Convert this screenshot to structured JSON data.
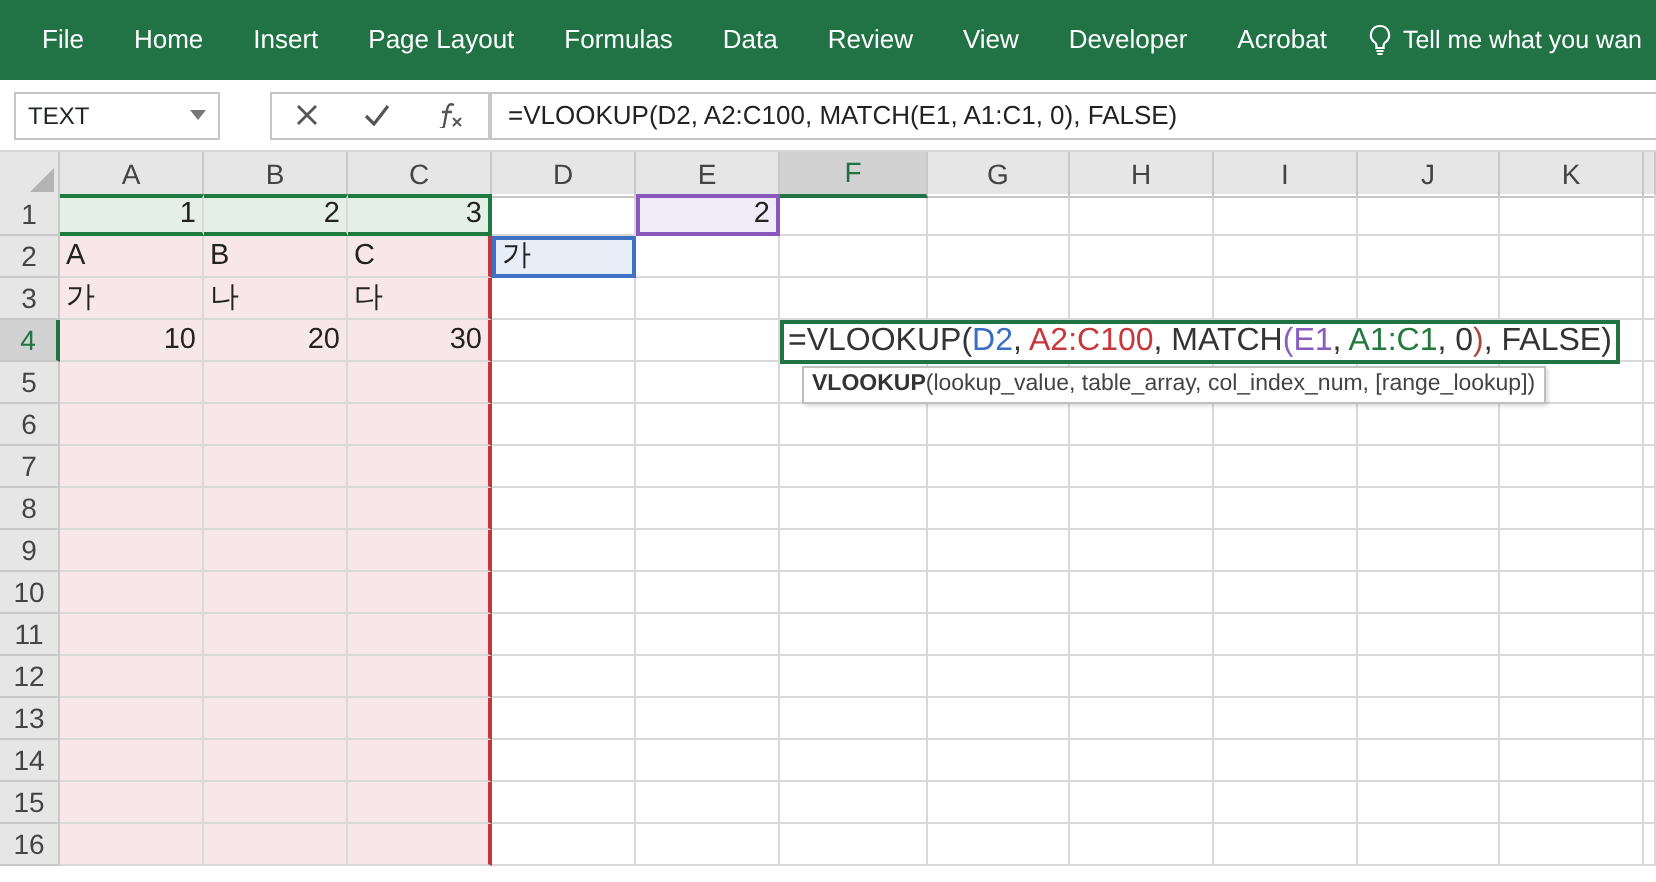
{
  "ribbon": {
    "tabs": [
      "File",
      "Home",
      "Insert",
      "Page Layout",
      "Formulas",
      "Data",
      "Review",
      "View",
      "Developer",
      "Acrobat"
    ],
    "tell_me": "Tell me what you wan"
  },
  "name_box": {
    "value": "TEXT"
  },
  "formula_bar": {
    "value": "=VLOOKUP(D2, A2:C100, MATCH(E1, A1:C1, 0), FALSE)"
  },
  "columns": [
    {
      "label": "A",
      "selected": false
    },
    {
      "label": "B",
      "selected": false
    },
    {
      "label": "C",
      "selected": false
    },
    {
      "label": "D",
      "selected": false
    },
    {
      "label": "E",
      "selected": false
    },
    {
      "label": "F",
      "selected": true
    },
    {
      "label": "G",
      "selected": false
    },
    {
      "label": "H",
      "selected": false
    },
    {
      "label": "I",
      "selected": false
    },
    {
      "label": "J",
      "selected": false
    },
    {
      "label": "K",
      "selected": false
    }
  ],
  "rows": [
    {
      "label": "1",
      "selected": false,
      "cells": [
        {
          "value": "1",
          "kind": "number",
          "color": "#e4efe8"
        },
        {
          "value": "2",
          "kind": "number",
          "color": "#e4efe8"
        },
        {
          "value": "3",
          "kind": "number",
          "color": "#e4efe8"
        },
        null,
        {
          "value": "2",
          "kind": "number",
          "color": "#f1ebf7"
        },
        null,
        null,
        null,
        null,
        null,
        null
      ]
    },
    {
      "label": "2",
      "selected": false,
      "cells": [
        {
          "value": "A",
          "kind": "text",
          "color": "#f8e7e8"
        },
        {
          "value": "B",
          "kind": "text",
          "color": "#f8e7e8"
        },
        {
          "value": "C",
          "kind": "text",
          "color": "#f8e7e8"
        },
        {
          "value": "가",
          "kind": "text",
          "color": "#e8eef8"
        },
        null,
        null,
        null,
        null,
        null,
        null,
        null
      ]
    },
    {
      "label": "3",
      "selected": false,
      "cells": [
        {
          "value": "가",
          "kind": "text",
          "color": "#f8e7e8"
        },
        {
          "value": "나",
          "kind": "text",
          "color": "#f8e7e8"
        },
        {
          "value": "다",
          "kind": "text",
          "color": "#f8e7e8"
        },
        null,
        null,
        null,
        null,
        null,
        null,
        null,
        null
      ]
    },
    {
      "label": "4",
      "selected": true,
      "cells": [
        {
          "value": "10",
          "kind": "number",
          "color": "#f8e7e8"
        },
        {
          "value": "20",
          "kind": "number",
          "color": "#f8e7e8"
        },
        {
          "value": "30",
          "kind": "number",
          "color": "#f8e7e8"
        },
        null,
        null,
        {
          "kind": "editing",
          "segments": [
            {
              "text": "=VLOOKUP(",
              "color": "#333333"
            },
            {
              "text": "D2",
              "color": "#3b6fc4"
            },
            {
              "text": ", ",
              "color": "#333333"
            },
            {
              "text": "A2:C100",
              "color": "#c8373b"
            },
            {
              "text": ", MATCH",
              "color": "#333333"
            },
            {
              "text": "(E1",
              "color": "#8a5cc0"
            },
            {
              "text": ", ",
              "color": "#333333"
            },
            {
              "text": "A1:C1",
              "color": "#217a3c"
            },
            {
              "text": ", 0",
              "color": "#333333"
            },
            {
              "text": ")",
              "color": "#a84a3a"
            },
            {
              "text": ", FALSE)",
              "color": "#333333"
            }
          ],
          "tooltip": "**VLOOKUP**(lookup_value, table_array, col_index_num, [range_lookup])"
        },
        null,
        null,
        null,
        null,
        null
      ]
    },
    {
      "label": "5",
      "selected": false,
      "cells": [
        {
          "color": "#f8e7e8"
        },
        {
          "color": "#f8e7e8"
        },
        {
          "color": "#f8e7e8"
        },
        null,
        null,
        null,
        null,
        null,
        null,
        null,
        null
      ]
    },
    {
      "label": "6",
      "selected": false,
      "cells": [
        {
          "color": "#f8e7e8"
        },
        {
          "color": "#f8e7e8"
        },
        {
          "color": "#f8e7e8"
        },
        null,
        null,
        null,
        null,
        null,
        null,
        null,
        null
      ]
    },
    {
      "label": "7",
      "selected": false,
      "cells": [
        {
          "color": "#f8e7e8"
        },
        {
          "color": "#f8e7e8"
        },
        {
          "color": "#f8e7e8"
        },
        null,
        null,
        null,
        null,
        null,
        null,
        null,
        null
      ]
    },
    {
      "label": "8",
      "selected": false,
      "cells": [
        {
          "color": "#f8e7e8"
        },
        {
          "color": "#f8e7e8"
        },
        {
          "color": "#f8e7e8"
        },
        null,
        null,
        null,
        null,
        null,
        null,
        null,
        null
      ]
    },
    {
      "label": "9",
      "selected": false,
      "cells": [
        {
          "color": "#f8e7e8"
        },
        {
          "color": "#f8e7e8"
        },
        {
          "color": "#f8e7e8"
        },
        null,
        null,
        null,
        null,
        null,
        null,
        null,
        null
      ]
    },
    {
      "label": "10",
      "selected": false,
      "cells": [
        {
          "color": "#f8e7e8"
        },
        {
          "color": "#f8e7e8"
        },
        {
          "color": "#f8e7e8"
        },
        null,
        null,
        null,
        null,
        null,
        null,
        null,
        null
      ]
    },
    {
      "label": "11",
      "selected": false,
      "cells": [
        {
          "color": "#f8e7e8"
        },
        {
          "color": "#f8e7e8"
        },
        {
          "color": "#f8e7e8"
        },
        null,
        null,
        null,
        null,
        null,
        null,
        null,
        null
      ]
    },
    {
      "label": "12",
      "selected": false,
      "cells": [
        {
          "color": "#f8e7e8"
        },
        {
          "color": "#f8e7e8"
        },
        {
          "color": "#f8e7e8"
        },
        null,
        null,
        null,
        null,
        null,
        null,
        null,
        null
      ]
    },
    {
      "label": "13",
      "selected": false,
      "cells": [
        {
          "color": "#f8e7e8"
        },
        {
          "color": "#f8e7e8"
        },
        {
          "color": "#f8e7e8"
        },
        null,
        null,
        null,
        null,
        null,
        null,
        null,
        null
      ]
    },
    {
      "label": "14",
      "selected": false,
      "cells": [
        {
          "color": "#f8e7e8"
        },
        {
          "color": "#f8e7e8"
        },
        {
          "color": "#f8e7e8"
        },
        null,
        null,
        null,
        null,
        null,
        null,
        null,
        null
      ]
    },
    {
      "label": "15",
      "selected": false,
      "cells": [
        {
          "color": "#f8e7e8"
        },
        {
          "color": "#f8e7e8"
        },
        {
          "color": "#f8e7e8"
        },
        null,
        null,
        null,
        null,
        null,
        null,
        null,
        null
      ]
    },
    {
      "label": "16",
      "selected": false,
      "cells": [
        {
          "color": "#f8e7e8"
        },
        {
          "color": "#f8e7e8"
        },
        {
          "color": "#f8e7e8"
        },
        null,
        null,
        null,
        null,
        null,
        null,
        null,
        null
      ]
    }
  ]
}
